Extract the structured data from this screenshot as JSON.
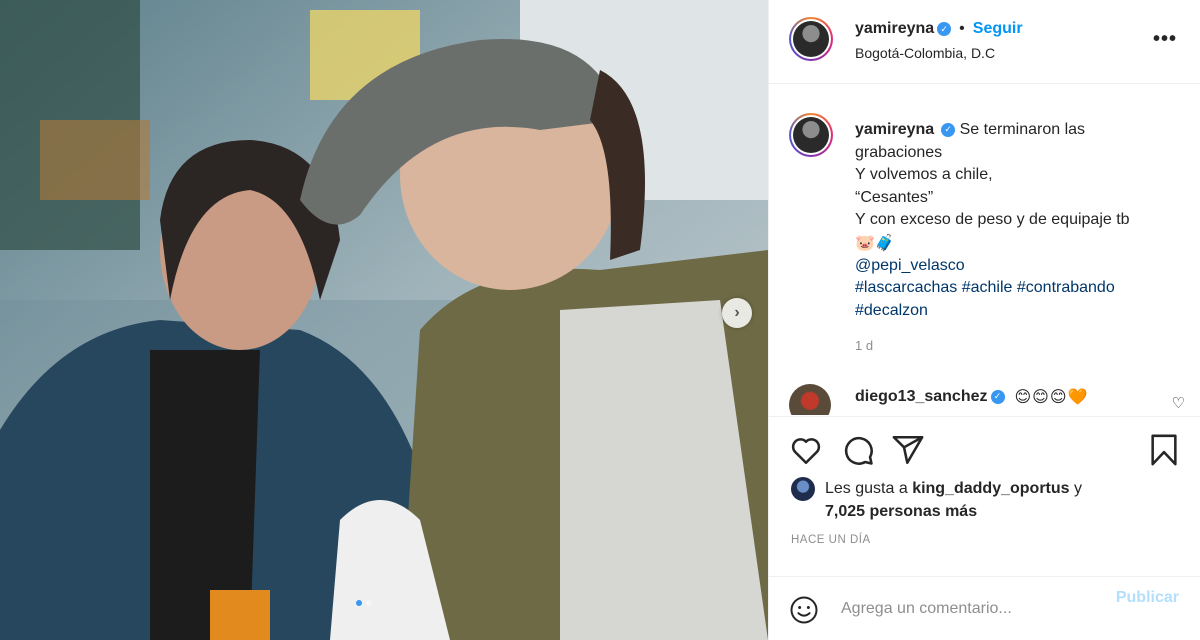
{
  "post": {
    "photo": {
      "alt_icon": "photo",
      "next_icon": "chevron-right-icon",
      "carousel_count": 2,
      "carousel_active": 0
    },
    "header": {
      "username": "yamireyna",
      "verified_icon": "verified-badge-icon",
      "bullet": "•",
      "follow_label": "Seguir",
      "location": "Bogotá-Colombia, D.C",
      "more_icon": "more-options-icon",
      "more_label": "•••"
    },
    "caption": {
      "username": "yamireyna",
      "lines": [
        "Se terminaron las",
        "grabaciones",
        "Y volvemos a chile,",
        "“Cesantes”",
        "Y con exceso de peso y de equipaje tb"
      ],
      "emoji_line": "🐷🧳",
      "mention": "@pepi_velasco",
      "hashtags_line1": "#lascarcachas #achile #contrabando",
      "hashtags_line2": "#decalzon",
      "time_ago": "1 d"
    },
    "comment": {
      "username": "diego13_sanchez",
      "text": "😊😊😊🧡"
    },
    "actions": {
      "like_icon": "heart-icon",
      "comment_icon": "comment-icon",
      "share_icon": "share-icon",
      "save_icon": "bookmark-icon"
    },
    "likes": {
      "prefix": "Les gusta a",
      "first_liker": "king_daddy_oportus",
      "conjunction": "y",
      "others": "7,025 personas más"
    },
    "timestamp": "HACE UN DÍA",
    "comment_box": {
      "emoji_icon": "smiley-icon",
      "placeholder": "Agrega un comentario...",
      "publish_label": "Publicar"
    }
  }
}
